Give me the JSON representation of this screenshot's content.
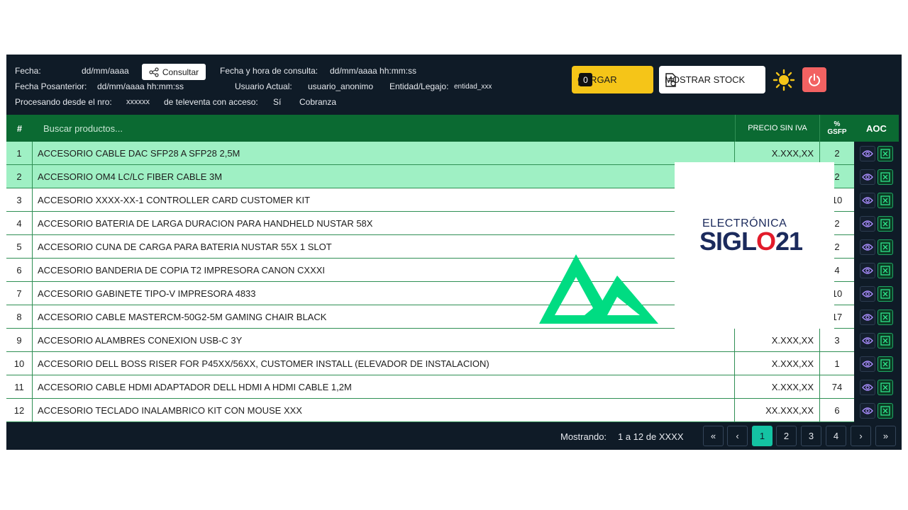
{
  "header": {
    "fecha_label": "Fecha:",
    "fecha_value": "dd/mm/aaaa",
    "consultar_label": "Consultar",
    "fecha_hora_label": "Fecha y hora de consulta:",
    "fecha_hora_value": "dd/mm/aaaa hh:mm:ss",
    "fecha_pos_label": "Fecha Posanterior:",
    "fecha_pos_value": "dd/mm/aaaa hh:mm:ss",
    "usuario_label": "Usuario Actual:",
    "usuario_value": "usuario_anonimo",
    "entidad_label": "Entidad/Legajo:",
    "entidad_value": "entidad_xxx",
    "procesando_label": "Procesando desde el nro:",
    "procesando_value": "xxxxxx",
    "televenta_label": "de televenta con acceso:",
    "televenta_value": "Sí",
    "cobranza_label": "Cobranza"
  },
  "actions": {
    "cargar_label": "CARGAR",
    "cargar_count": "0",
    "stock_label": "MOSTRAR STOCK"
  },
  "colors": {
    "accent_yellow": "#f5c518",
    "header_green": "#0b6a32",
    "row_highlight": "#9ff0c4",
    "power_red": "#f26262",
    "active_page": "#14c3a3"
  },
  "table": {
    "col_num": "#",
    "search_placeholder": "Buscar productos...",
    "col_price": "PRECIO SIN IVA",
    "col_pct_line1": "%",
    "col_pct_line2": "GSFP",
    "col_aoc": "AOC",
    "rows": [
      {
        "num": "1",
        "desc": "ACCESORIO CABLE DAC SFP28 A SFP28 2,5M",
        "price": "X.XXX,XX",
        "pct": "2",
        "highlight": true
      },
      {
        "num": "2",
        "desc": "ACCESORIO OM4 LC/LC FIBER CABLE 3M",
        "price": "",
        "pct": "2",
        "highlight": true
      },
      {
        "num": "3",
        "desc": "ACCESORIO XXXX-XX-1 CONTROLLER CARD CUSTOMER KIT",
        "price": "",
        "pct": "10",
        "highlight": false
      },
      {
        "num": "4",
        "desc": "ACCESORIO BATERIA DE LARGA DURACION PARA HANDHELD NUSTAR 58X",
        "price": "",
        "pct": "2",
        "highlight": false
      },
      {
        "num": "5",
        "desc": "ACCESORIO CUNA DE CARGA PARA BATERIA NUSTAR 55X 1 SLOT",
        "price": "",
        "pct": "2",
        "highlight": false
      },
      {
        "num": "6",
        "desc": "ACCESORIO BANDERIA DE COPIA T2 IMPRESORA CANON CXXXI",
        "price": "",
        "pct": "4",
        "highlight": false
      },
      {
        "num": "7",
        "desc": "ACCESORIO GABINETE TIPO-V IMPRESORA 4833",
        "price": "",
        "pct": "10",
        "highlight": false
      },
      {
        "num": "8",
        "desc": "ACCESORIO CABLE MASTERCM-50G2-5M GAMING CHAIR BLACK",
        "price": "",
        "pct": "17",
        "highlight": false
      },
      {
        "num": "9",
        "desc": "ACCESORIO ALAMBRES CONEXION USB-C 3Y",
        "price": "X.XXX,XX",
        "pct": "3",
        "highlight": false
      },
      {
        "num": "10",
        "desc": "ACCESORIO DELL BOSS RISER FOR P45XX/56XX, CUSTOMER INSTALL (ELEVADOR DE INSTALACION)",
        "price": "X.XXX,XX",
        "pct": "1",
        "highlight": false
      },
      {
        "num": "11",
        "desc": "ACCESORIO CABLE HDMI ADAPTADOR DELL HDMI A HDMI CABLE 1,2M",
        "price": "X.XXX,XX",
        "pct": "74",
        "highlight": false
      },
      {
        "num": "12",
        "desc": "ACCESORIO TECLADO INALAMBRICO KIT CON MOUSE XXX",
        "price": "XX.XXX,XX",
        "pct": "6",
        "highlight": false
      }
    ]
  },
  "footer": {
    "mostrando_label": "Mostrando:",
    "mostrando_value": "1 a 12 de XXXX",
    "first": "«",
    "prev": "‹",
    "pages": [
      "1",
      "2",
      "3",
      "4"
    ],
    "next": "›",
    "last": "»"
  },
  "overlay": {
    "logo_line1": "ELECTRÓNICA",
    "logo_line2a": "SIGL",
    "logo_line2b": "O",
    "logo_line2c": "21"
  }
}
